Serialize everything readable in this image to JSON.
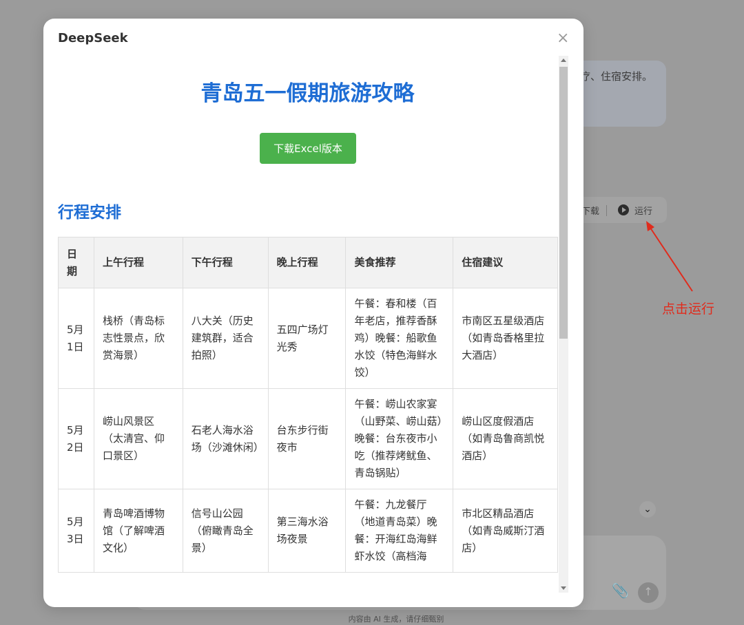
{
  "background": {
    "bubble_text": "疗、住宿安排。",
    "toolbar": {
      "download_label": "下载",
      "run_label": "运行"
    },
    "annotation": "点击运行",
    "disclaimer": "内容由 AI 生成，请仔细甄别"
  },
  "modal": {
    "title": "DeepSeek",
    "close_label": "×",
    "page_title": "青岛五一假期旅游攻略",
    "download_button": "下载Excel版本",
    "section_title": "行程安排",
    "table": {
      "headers": [
        "日期",
        "上午行程",
        "下午行程",
        "晚上行程",
        "美食推荐",
        "住宿建议"
      ],
      "rows": [
        [
          "5月1日",
          "栈桥（青岛标志性景点，欣赏海景）",
          "八大关（历史建筑群，适合拍照）",
          "五四广场灯光秀",
          "午餐：春和楼（百年老店，推荐香酥鸡）晚餐：船歌鱼水饺（特色海鲜水饺）",
          "市南区五星级酒店（如青岛香格里拉大酒店）"
        ],
        [
          "5月2日",
          "崂山风景区（太清宫、仰口景区）",
          "石老人海水浴场（沙滩休闲）",
          "台东步行街夜市",
          "午餐：崂山农家宴（山野菜、崂山菇）晚餐：台东夜市小吃（推荐烤鱿鱼、青岛锅贴）",
          "崂山区度假酒店（如青岛鲁商凯悦酒店）"
        ],
        [
          "5月3日",
          "青岛啤酒博物馆（了解啤酒文化）",
          "信号山公园（俯瞰青岛全景）",
          "第三海水浴场夜景",
          "午餐：九龙餐厅（地道青岛菜）晚餐：开海红岛海鲜虾水饺（高档海",
          "市北区精品酒店（如青岛威斯汀酒店）"
        ]
      ]
    }
  },
  "colors": {
    "heading_blue": "#1e6dd4",
    "button_green": "#4bb14c",
    "annotation_red": "#e02b1c"
  }
}
